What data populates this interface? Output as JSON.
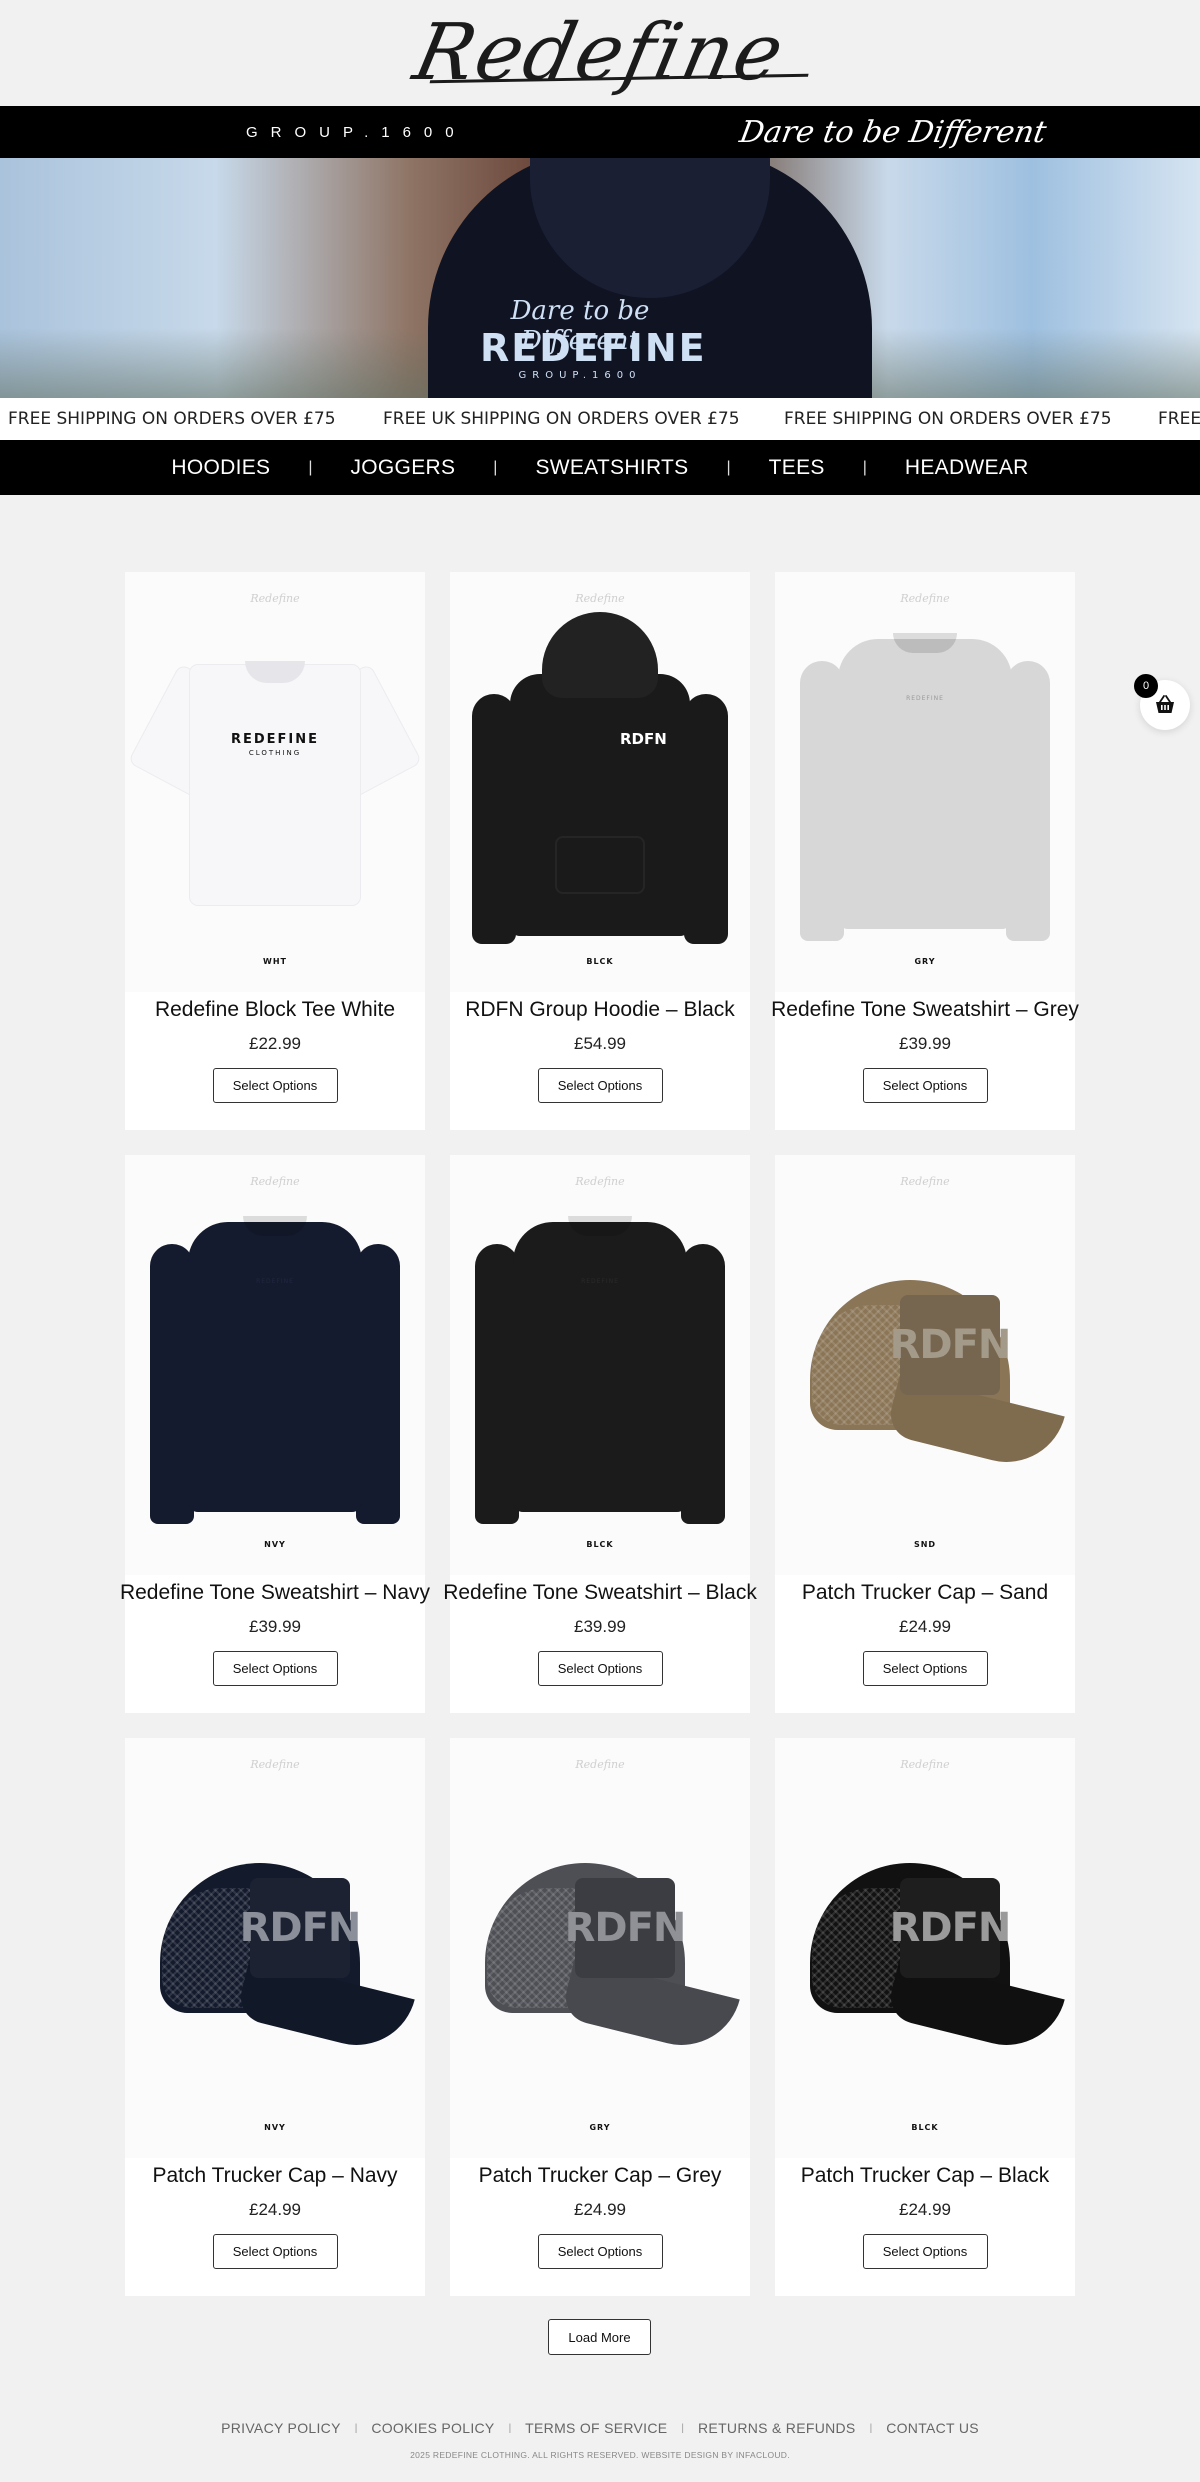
{
  "header": {
    "logo_text": "Redefine"
  },
  "brand_strip": {
    "group_text": "GROUP.1600",
    "tagline": "Dare to be Different"
  },
  "hero": {
    "print_tagline": "Dare to be Different",
    "print_brand": "REDEFINE",
    "print_group": "GROUP.1600"
  },
  "marquee": {
    "items": [
      "FREE SHIPPING ON ORDERS OVER £75",
      "FREE UK SHIPPING ON ORDERS OVER £75",
      "FREE SHIPPING ON ORDERS OVER £75",
      "FREE"
    ]
  },
  "nav": {
    "items": [
      {
        "label": "HOODIES"
      },
      {
        "label": "JOGGERS"
      },
      {
        "label": "SWEATSHIRTS"
      },
      {
        "label": "TEES"
      },
      {
        "label": "HEADWEAR"
      }
    ],
    "separator": "|"
  },
  "products": [
    {
      "title": "Redefine Block Tee White",
      "price": "£22.99",
      "button": "Select Options",
      "code": "WHT",
      "kind": "tee",
      "color": "#f7f7f9",
      "print": "REDEFINE",
      "print_sub": "CLOTHING",
      "print_color": "#111111"
    },
    {
      "title": "RDFN Group Hoodie – Black",
      "price": "£54.99",
      "button": "Select Options",
      "code": "BLCK",
      "kind": "hoodie",
      "color": "#1a1a1a",
      "print": "RDFN"
    },
    {
      "title": "Redefine Tone Sweatshirt – Grey",
      "price": "£39.99",
      "button": "Select Options",
      "code": "GRY",
      "kind": "sweat",
      "color": "#d7d7d7",
      "print": "REDEFINE",
      "print_color": "#9a9a9a"
    },
    {
      "title": "Redefine Tone Sweatshirt – Navy",
      "price": "£39.99",
      "button": "Select Options",
      "code": "NVY",
      "kind": "sweat",
      "color": "#151b2e",
      "print": "REDEFINE",
      "print_color": "#1f2740"
    },
    {
      "title": "Redefine Tone Sweatshirt – Black",
      "price": "£39.99",
      "button": "Select Options",
      "code": "BLCK",
      "kind": "sweat",
      "color": "#1b1b1b",
      "print": "REDEFINE",
      "print_color": "#2a2a2a"
    },
    {
      "title": "Patch Trucker Cap – Sand",
      "price": "£24.99",
      "button": "Select Options",
      "code": "SND",
      "kind": "cap",
      "color": "#8a7556",
      "patch_color": "#76664f",
      "print": "RDFN",
      "print_color": "#a49a8a"
    },
    {
      "title": "Patch Trucker Cap – Navy",
      "price": "£24.99",
      "button": "Select Options",
      "code": "NVY",
      "kind": "cap",
      "color": "#131a2c",
      "patch_color": "#1d2233",
      "print": "RDFN",
      "print_color": "#8b8f99"
    },
    {
      "title": "Patch Trucker Cap – Grey",
      "price": "£24.99",
      "button": "Select Options",
      "code": "GRY",
      "kind": "cap",
      "color": "#4e4f55",
      "patch_color": "#3c3d42",
      "print": "RDFN",
      "print_color": "#8f9197"
    },
    {
      "title": "Patch Trucker Cap – Black",
      "price": "£24.99",
      "button": "Select Options",
      "code": "BLCK",
      "kind": "cap",
      "color": "#111111",
      "patch_color": "#1e1e1e",
      "print": "RDFN",
      "print_color": "#9a9a9a"
    }
  ],
  "watermark": "Redefine",
  "load_more": "Load More",
  "cart": {
    "count": "0"
  },
  "footer": {
    "links": [
      "PRIVACY POLICY",
      "COOKIES POLICY",
      "TERMS OF SERVICE",
      "RETURNS & REFUNDS",
      "CONTACT US"
    ],
    "copyright": "2025 REDEFINE CLOTHING. ALL RIGHTS RESERVED. WEBSITE DESIGN BY INFACLOUD."
  }
}
